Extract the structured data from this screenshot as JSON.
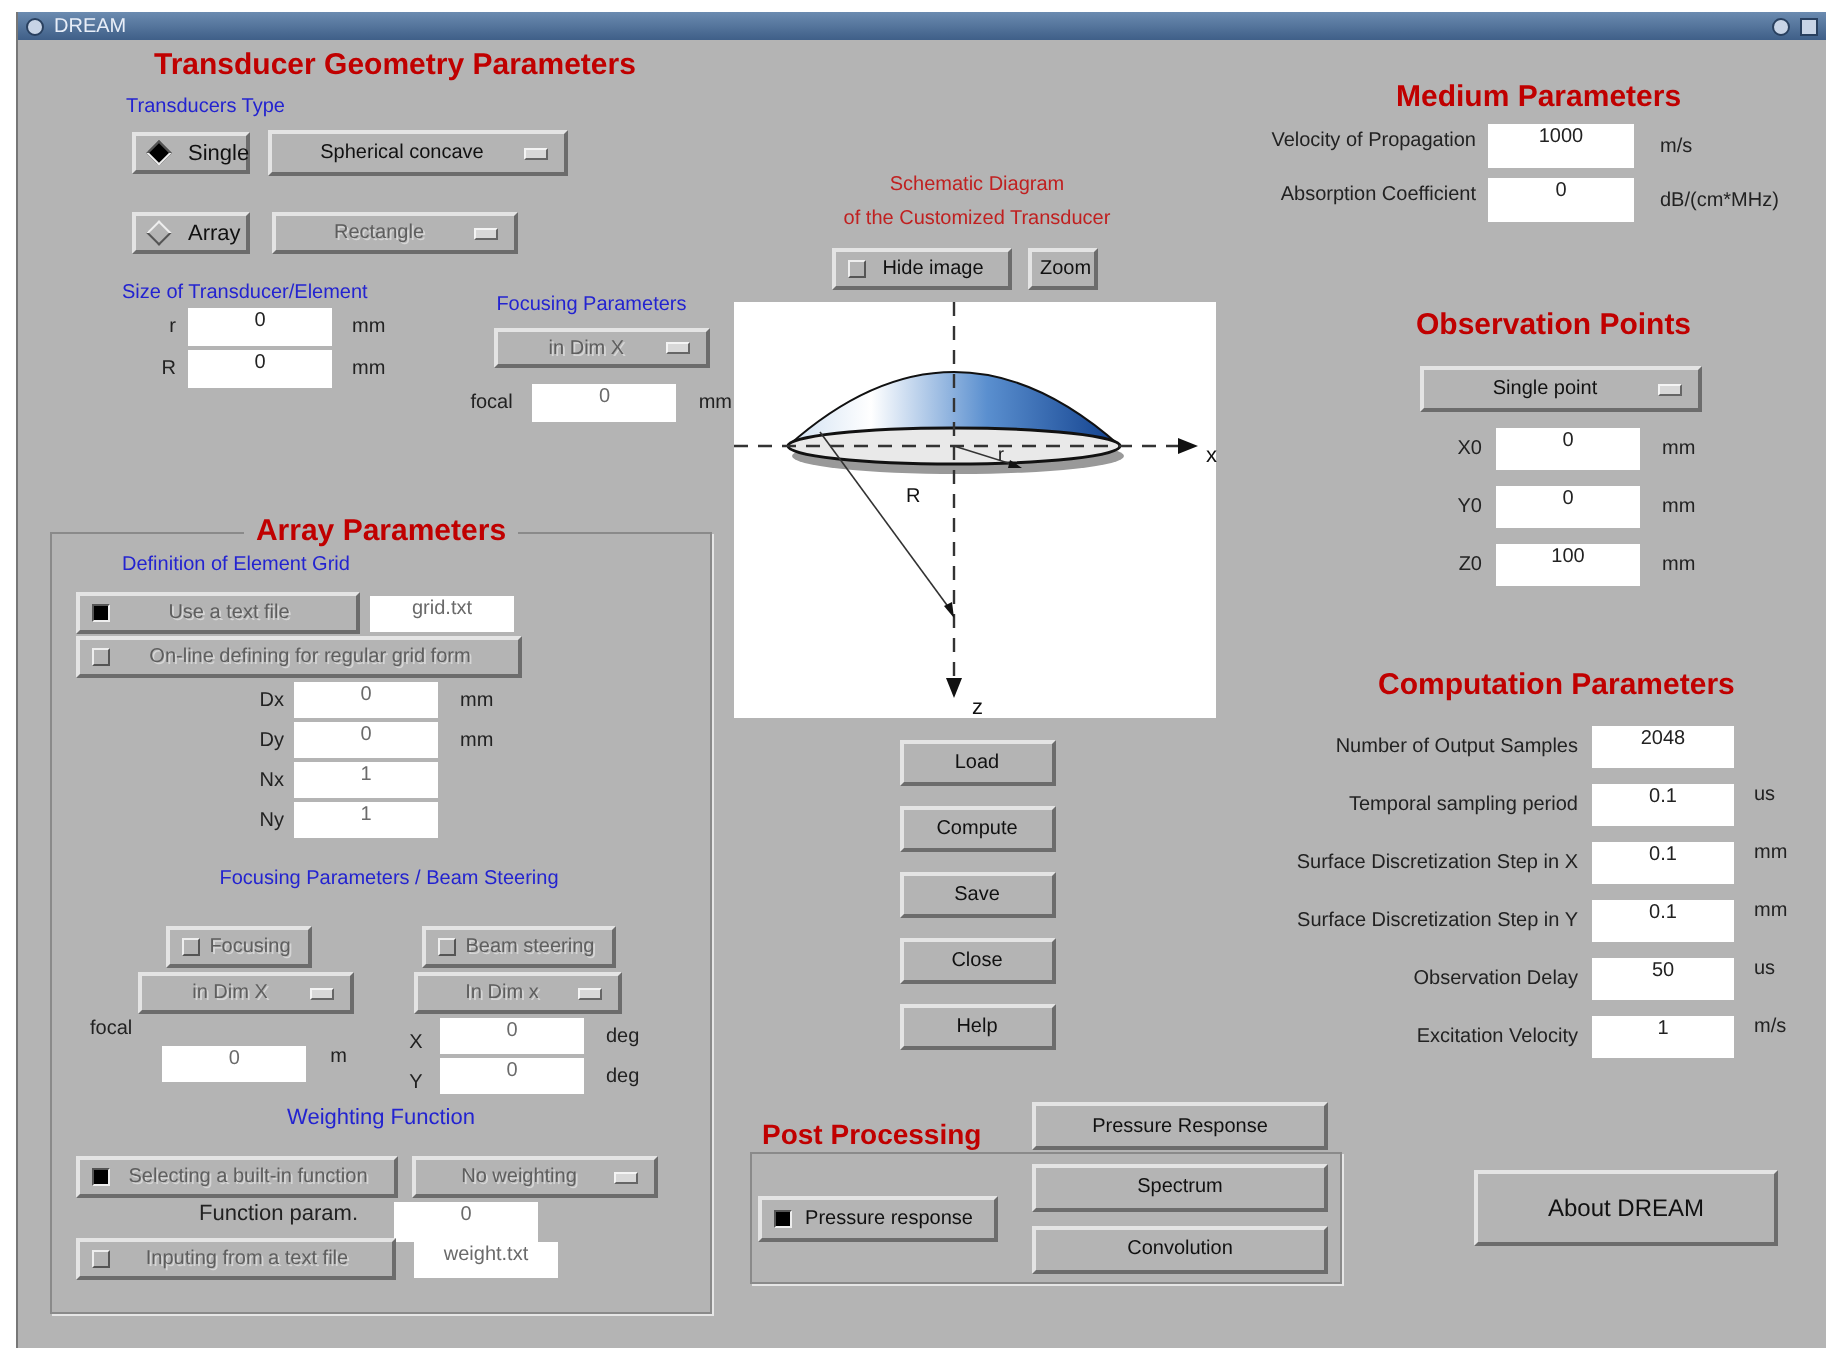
{
  "window": {
    "title": "DREAM"
  },
  "geometry": {
    "title": "Transducer Geometry Parameters",
    "type_label": "Transducers Type",
    "types": [
      {
        "label": "Single",
        "selected": true,
        "shape": {
          "label": "Spherical concave",
          "disabled": false
        }
      },
      {
        "label": "Array",
        "selected": false,
        "shape": {
          "label": "Rectangle",
          "disabled": true
        }
      }
    ],
    "size_label": "Size of Transducer/Element",
    "size_fields": [
      {
        "label": "r",
        "value": "0",
        "unit": "mm"
      },
      {
        "label": "R",
        "value": "0",
        "unit": "mm"
      }
    ],
    "focusing": {
      "title": "Focusing Parameters",
      "mode": "in Dim X",
      "label": "focal",
      "value": "0",
      "unit": "mm",
      "disabled": true
    }
  },
  "array": {
    "title": "Array Parameters",
    "disabled": true,
    "grid_label": "Definition of Element Grid",
    "use_file": {
      "label": "Use a text file",
      "checked": true,
      "file": "grid.txt"
    },
    "online": {
      "label": "On-line defining for regular grid form",
      "checked": false
    },
    "grid_fields": [
      {
        "label": "Dx",
        "value": "0",
        "unit": "mm"
      },
      {
        "label": "Dy",
        "value": "0",
        "unit": "mm"
      },
      {
        "label": "Nx",
        "value": "1"
      },
      {
        "label": "Ny",
        "value": "1"
      }
    ],
    "steer_label": "Focusing Parameters / Beam Steering",
    "focusing": {
      "label": "Focusing",
      "checked": false,
      "mode": "in Dim X",
      "field_label": "focal",
      "value": "0",
      "unit": "m"
    },
    "steering": {
      "label": "Beam steering",
      "checked": false,
      "mode": "In Dim x",
      "fields": [
        {
          "label": "X",
          "value": "0",
          "unit": "deg"
        },
        {
          "label": "Y",
          "value": "0",
          "unit": "deg"
        }
      ]
    },
    "weighting_label": "Weighting Function",
    "builtin": {
      "label": "Selecting a built-in function",
      "checked": true,
      "mode": "No weighting",
      "param_label": "Function param.",
      "param_value": "0"
    },
    "from_file": {
      "label": "Inputing from a text file",
      "checked": false,
      "file": "weight.txt"
    }
  },
  "diagram": {
    "title": "Schematic Diagram",
    "subtitle": "of the Customized Transducer",
    "hide_image": {
      "label": "Hide image",
      "checked": false
    },
    "zoom": "Zoom",
    "labels": {
      "x": "x",
      "z": "z",
      "big_r": "R",
      "small_r": "r"
    }
  },
  "actions": [
    "Load",
    "Compute",
    "Save",
    "Close",
    "Help"
  ],
  "medium": {
    "title": "Medium Parameters",
    "fields": [
      {
        "label": "Velocity of Propagation",
        "value": "1000",
        "unit": "m/s"
      },
      {
        "label": "Absorption Coefficient",
        "value": "0",
        "unit": "dB/(cm*MHz)"
      }
    ]
  },
  "observation": {
    "title": "Observation Points",
    "mode": "Single point",
    "fields": [
      {
        "label": "X0",
        "value": "0",
        "unit": "mm"
      },
      {
        "label": "Y0",
        "value": "0",
        "unit": "mm"
      },
      {
        "label": "Z0",
        "value": "100",
        "unit": "mm"
      }
    ]
  },
  "computation": {
    "title": "Computation Parameters",
    "fields": [
      {
        "label": "Number of Output Samples",
        "value": "2048"
      },
      {
        "label": "Temporal sampling period",
        "value": "0.1",
        "unit": "us"
      },
      {
        "label": "Surface Discretization Step in X",
        "value": "0.1",
        "unit": "mm"
      },
      {
        "label": "Surface Discretization Step in Y",
        "value": "0.1",
        "unit": "mm"
      },
      {
        "label": "Observation Delay",
        "value": "50",
        "unit": "us"
      },
      {
        "label": "Excitation Velocity",
        "value": "1",
        "unit": "m/s"
      }
    ]
  },
  "post": {
    "title": "Post Processing",
    "pressure_response": {
      "label": "Pressure response",
      "checked": true
    },
    "buttons": [
      "Pressure Response",
      "Spectrum",
      "Convolution"
    ]
  },
  "about": "About  DREAM"
}
